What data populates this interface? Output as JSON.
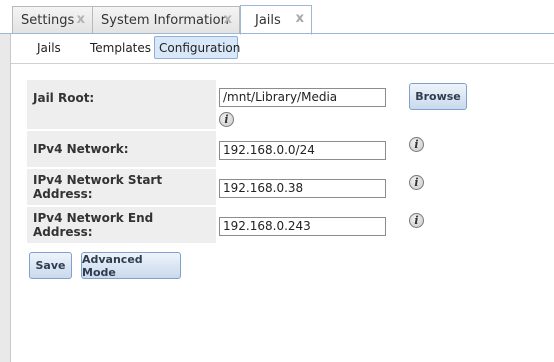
{
  "tabs": [
    {
      "label": "Settings",
      "close": "x"
    },
    {
      "label": "System Information",
      "close": "x"
    },
    {
      "label": "Jails",
      "close": "x"
    }
  ],
  "subtabs": [
    {
      "label": "Jails"
    },
    {
      "label": "Templates"
    },
    {
      "label": "Configuration"
    }
  ],
  "form": {
    "jail_root": {
      "label": "Jail Root:",
      "value": "/mnt/Library/Media",
      "browse": "Browse"
    },
    "ipv4_network": {
      "label": "IPv4 Network:",
      "value": "192.168.0.0/24"
    },
    "ipv4_start": {
      "label": "IPv4 Network Start Address:",
      "value": "192.168.0.38"
    },
    "ipv4_end": {
      "label": "IPv4 Network End Address:",
      "value": "192.168.0.243"
    },
    "info_glyph": "i"
  },
  "buttons": {
    "save": "Save",
    "advanced": "Advanced Mode"
  }
}
